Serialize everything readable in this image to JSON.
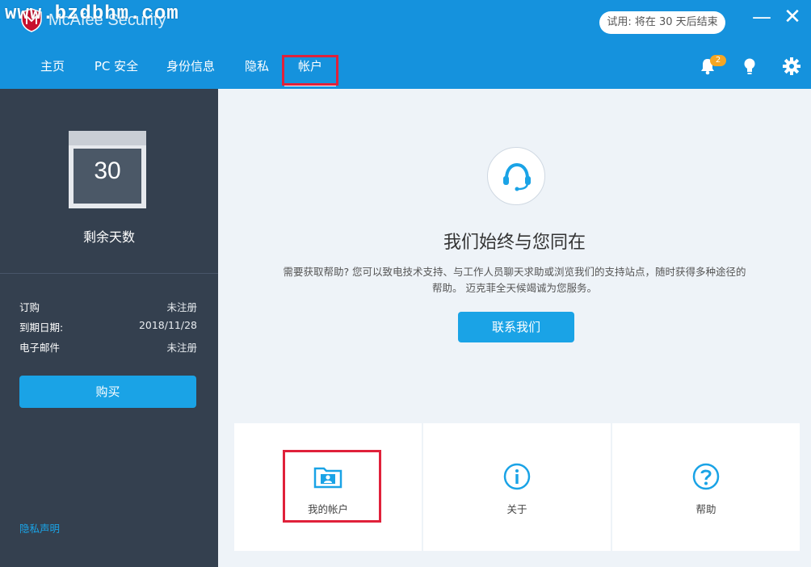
{
  "window": {
    "brand": "McAfee Security",
    "watermark": "www.bzdbhm.com",
    "trial_notice": "试用: 将在 30 天后结束"
  },
  "nav": {
    "tabs": [
      {
        "label": "主页"
      },
      {
        "label": "PC 安全"
      },
      {
        "label": "身份信息"
      },
      {
        "label": "隐私"
      },
      {
        "label": "帐户"
      }
    ],
    "active_tab": "帐户",
    "notification_count": "2"
  },
  "sidebar": {
    "days_remaining": "30",
    "days_label": "剩余天数",
    "rows": [
      {
        "key": "订购",
        "value": "未注册"
      },
      {
        "key": "到期日期:",
        "value": "2018/11/28"
      },
      {
        "key": "电子邮件",
        "value": "未注册"
      }
    ],
    "buy_label": "购买",
    "privacy_label": "隐私声明"
  },
  "main": {
    "headline": "我们始终与您同在",
    "desc_line1": "需要获取帮助? 您可以致电技术支持、与工作人员聊天求助或浏览我们的支持站点，随时获得多种途径的",
    "desc_line2": "帮助。 迈克菲全天候竭诚为您服务。",
    "contact_label": "联系我们",
    "cards": [
      {
        "label": "我的帐户",
        "icon": "account-folder-icon"
      },
      {
        "label": "关于",
        "icon": "info-icon"
      },
      {
        "label": "帮助",
        "icon": "question-icon"
      }
    ]
  },
  "colors": {
    "header": "#1592dd",
    "sidebar": "#34404f",
    "accent": "#1aa3e6",
    "highlight": "#e0213a",
    "badge": "#f5a623",
    "main_bg": "#eef3f8"
  }
}
